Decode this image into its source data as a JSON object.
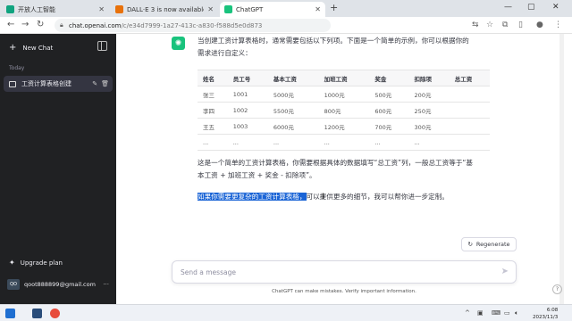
{
  "tabs": [
    {
      "title": "开放人工智能",
      "favicon_color": "#10a37f"
    },
    {
      "title": "DALL·E 3 is now available in C",
      "favicon_color": "#e8710a"
    },
    {
      "title": "ChatGPT",
      "favicon_color": "#19c37d"
    }
  ],
  "address": {
    "host": "chat.openai.com",
    "path": "/c/e34d7999-1a27-413c-a830-f588d5e0d873"
  },
  "sidebar": {
    "new_chat": "New Chat",
    "section_today": "Today",
    "chats": [
      {
        "label": "工资计算表格创建"
      }
    ],
    "upgrade": "Upgrade plan",
    "user_initials": "QO",
    "user_name": "qoot888899@gmail.com"
  },
  "message": {
    "intro_line1": "当创建工资计算表格时，通常需要包括以下列项。下面是一个简单的示例，你可以根据你的",
    "intro_line2": "需求进行自定义：",
    "table": {
      "headers": [
        "姓名",
        "员工号",
        "基本工资",
        "加班工资",
        "奖金",
        "扣除项",
        "总工资"
      ],
      "rows": [
        [
          "张三",
          "1001",
          "5000元",
          "1000元",
          "500元",
          "200元",
          ""
        ],
        [
          "李四",
          "1002",
          "5500元",
          "800元",
          "600元",
          "250元",
          ""
        ],
        [
          "王五",
          "1003",
          "6000元",
          "1200元",
          "700元",
          "300元",
          ""
        ],
        [
          "...",
          "...",
          "...",
          "...",
          "...",
          "...",
          ""
        ]
      ]
    },
    "outro_line1": "这是一个简单的工资计算表格，你需要根据具体的数据填写“总工资”列，一般总工资等于“基",
    "outro_line2": "本工资 + 加班工资 + 奖金 - 扣除项”。",
    "highlighted": "如果你需要更复杂的工资计算表格，",
    "final_rest": "可以提供更多的细节，我可以帮你进一步定制。"
  },
  "regenerate": "Regenerate",
  "composer_placeholder": "Send a message",
  "disclaimer": "ChatGPT can make mistakes. Verify important information.",
  "clock": {
    "time": "6:08",
    "date": "2023/11/3"
  },
  "colors": {
    "accent": "#19c37d",
    "sidebar_bg": "#202123",
    "highlight": "#1a64d6"
  }
}
